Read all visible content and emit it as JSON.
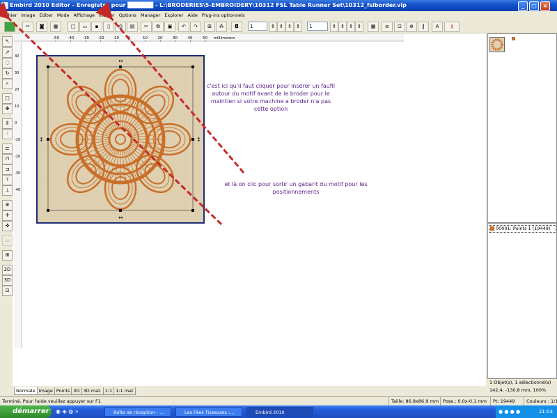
{
  "window": {
    "title": "Embird 2010 Editor - Enregistré pour ██████ - L:\\BRODERIES\\5-EMBROIDERY\\10312 FSL Table Runner Set\\10312_fslborder.vip",
    "min": "_",
    "max": "□",
    "close": "×"
  },
  "menu": [
    "Fichier",
    "Image",
    "Editer",
    "Mode",
    "Affichage",
    "Insérer",
    "Options",
    "Manager",
    "Explorer",
    "Aide",
    "Plug-ins optionnels"
  ],
  "toolbar": {
    "spin1": "1",
    "spin2": "1"
  },
  "ruler": {
    "ticks": [
      "-50",
      "-40",
      "-30",
      "-20",
      "-10",
      "0",
      "10",
      "20",
      "30",
      "40",
      "50"
    ],
    "unit": "millimeters",
    "vticks": [
      "40",
      "30",
      "20",
      "10",
      "0",
      "-10",
      "-20",
      "-30",
      "-40"
    ]
  },
  "annotations": {
    "note1": "c'est ici qu'il faut cliquer pour insérer un faufil autour du motif avant de le broder pour le maintien si votre machine a broder n'a pas cette option",
    "note2": "et là on clic pour sortir un gabarit du motif pour les positionnements",
    "arrow_color": "#c62828"
  },
  "tabs": [
    "Normale",
    "Image",
    "Points",
    "3D",
    "3D mat.",
    "1:1",
    "1:1 mat"
  ],
  "right": {
    "object_item": "00001:  Points 1 (19449)",
    "objects_selected": "1 Objet(s), 1 sélectionné(s)",
    "coords": "142.4, -130.8 mm, 100%"
  },
  "status": {
    "help": "Terminé. Pour l'aide veuillez appuyer sur F1",
    "size": "Taille: 86.8x86.9 mm",
    "pos": "Pose.: 0.0x-0.1 mm",
    "points": "Pt: 19449",
    "colors": "Couleurs : 1/1"
  },
  "taskbar": {
    "start": "démarrer",
    "tasks": [
      "Boîte de réception - ...",
      "Les Fées Tisseuses :...",
      "Embird 2010"
    ],
    "time": "21:03"
  },
  "colors": {
    "motif": "#c96f2a",
    "design_bg": "#ded0b0",
    "frame": "#1f2d7a"
  }
}
